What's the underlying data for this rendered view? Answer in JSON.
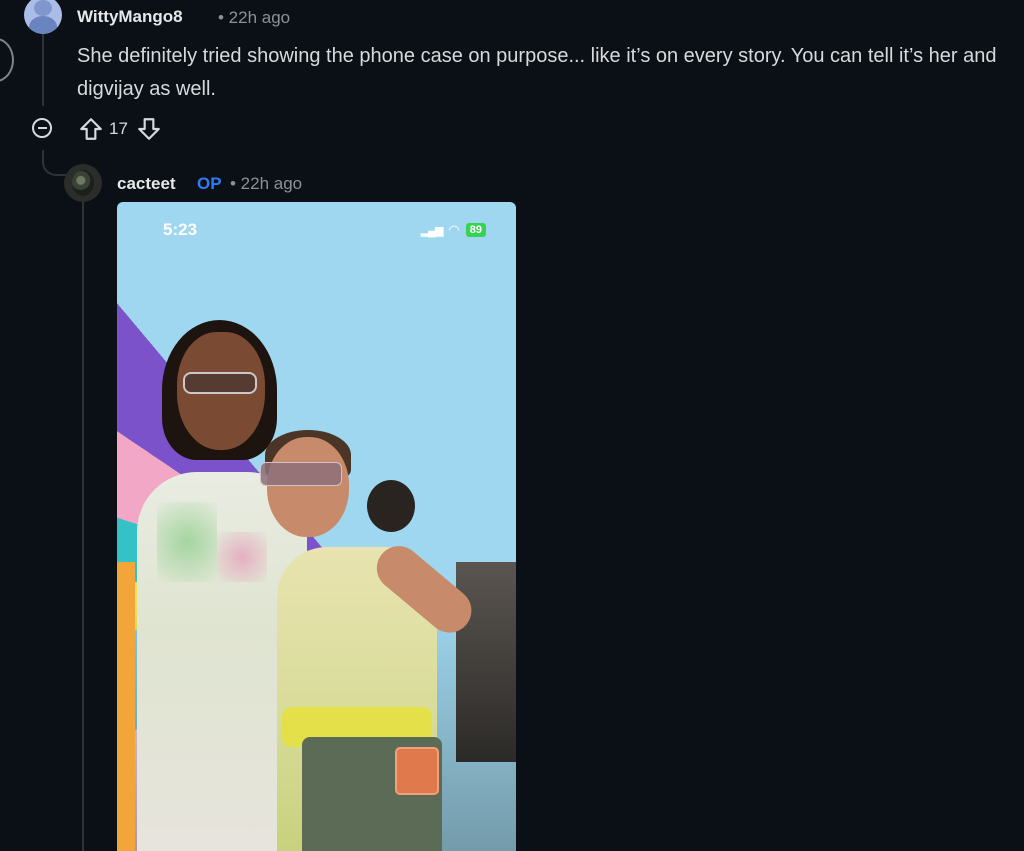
{
  "comment": {
    "username": "WittyMango8",
    "time": "• 22h ago",
    "text": "She definitely tried showing the phone case on purpose... like it’s on every story. You can tell it’s her and digvijay as well.",
    "votes": "17"
  },
  "reply": {
    "username": "cacteet",
    "badge": "OP",
    "time": "• 22h ago",
    "image": {
      "status_time": "5:23",
      "battery": "89"
    }
  },
  "icons": {
    "collapse": "minus-circle-icon",
    "upvote": "arrow-up-icon",
    "downvote": "arrow-down-icon",
    "wifi": "wifi-icon",
    "signal": "signal-icon",
    "battery": "battery-icon"
  },
  "colors": {
    "background": "#0b1016",
    "text": "#d7dadc",
    "meta": "#8b9196",
    "op_badge": "#2f7cf6",
    "battery": "#39d353"
  }
}
